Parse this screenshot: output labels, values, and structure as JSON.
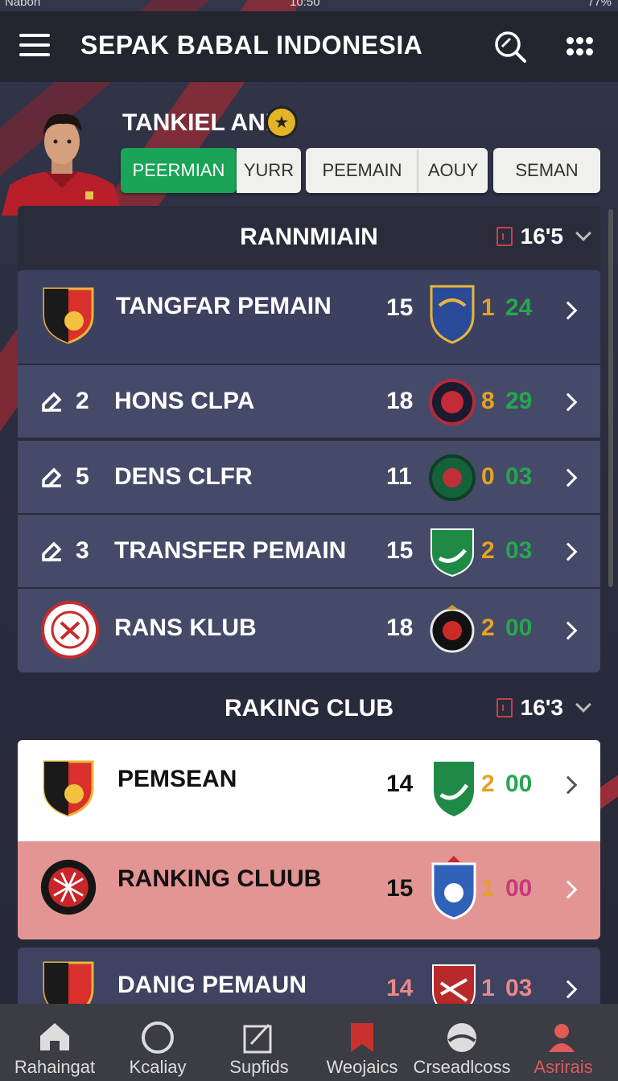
{
  "status_bar": {
    "carrier": "Nabon",
    "time": "10:50",
    "battery": "77%"
  },
  "app_bar": {
    "title": "SEPAK BABAL INDONESIA",
    "icons": [
      "menu-icon",
      "search-icon",
      "apps-grid-icon"
    ]
  },
  "player": {
    "name": "TANKIEL ANB"
  },
  "tabs": [
    {
      "label": "PEERMIAN",
      "active": true
    },
    {
      "label": "YURR"
    },
    {
      "label": "PEEMAIN"
    },
    {
      "label": "AOUY"
    },
    {
      "label": "SEMAN"
    }
  ],
  "section1": {
    "title": "RANNMIAIN",
    "meta": "16'5",
    "rows": [
      {
        "rank": "",
        "name": "TANGFAR PEMAIN",
        "num": "15",
        "a": "1",
        "b": "24"
      },
      {
        "rank": "2",
        "name": "HONS CLPA",
        "num": "18",
        "a": "8",
        "b": "29"
      },
      {
        "rank": "5",
        "name": "DENS CLFR",
        "num": "11",
        "a": "0",
        "b": "03"
      },
      {
        "rank": "3",
        "name": "TRANSFER PEMAIN",
        "num": "15",
        "a": "2",
        "b": "03"
      },
      {
        "rank": "",
        "name": "RANS KLUB",
        "num": "18",
        "a": "2",
        "b": "00"
      }
    ]
  },
  "section2": {
    "title": "RAKING CLUB",
    "meta": "16'3",
    "rows": [
      {
        "name": "PEMSEAN",
        "num": "14",
        "a": "2",
        "b": "00"
      },
      {
        "name": "RANKING CLUUB",
        "num": "15",
        "a": "1",
        "b": "00"
      },
      {
        "name": "DANIG PEMAUN",
        "num": "14",
        "a": "1",
        "b": "03"
      }
    ]
  },
  "bottom_nav": [
    {
      "label": "Rahaingat",
      "icon": "home-icon"
    },
    {
      "label": "Kcaliay",
      "icon": "compass-icon"
    },
    {
      "label": "Supfids",
      "icon": "edit-board-icon"
    },
    {
      "label": "Weojaics",
      "icon": "flag-icon"
    },
    {
      "label": "Crseadlcoss",
      "icon": "ball-icon"
    },
    {
      "label": "Asrirais",
      "icon": "profile-icon",
      "active": true
    }
  ],
  "colors": {
    "accent_green": "#19a457",
    "score_orange": "#e5a223",
    "score_green": "#27a64e",
    "active_red": "#e05a5a"
  }
}
